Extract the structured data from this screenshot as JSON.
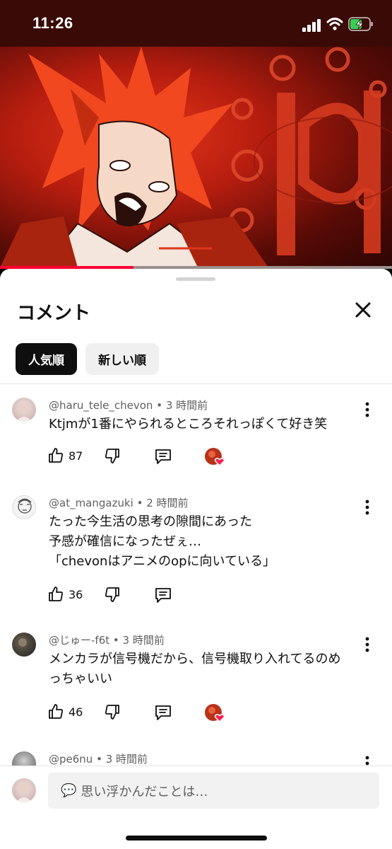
{
  "status_bar": {
    "time": "11:26",
    "icons": [
      "signal-icon",
      "wifi-icon",
      "battery-charging-icon"
    ]
  },
  "video": {
    "progress_fraction": 0.34,
    "accent_color": "#ff0033"
  },
  "sheet": {
    "title": "コメント",
    "close_icon": "close-icon",
    "chips": [
      {
        "label": "人気順",
        "active": true
      },
      {
        "label": "新しい順",
        "active": false
      }
    ]
  },
  "comments": [
    {
      "author": "@haru_tele_chevon",
      "time": "3 時間前",
      "lines": [
        "Ktjmが1番にやられるところそれっぽくて好き笑"
      ],
      "likes": "87",
      "creator_heart": true
    },
    {
      "author": "@at_mangazuki",
      "time": "2 時間前",
      "lines": [
        "たった今生活の思考の隙間にあった",
        "予感が確信になったぜぇ…",
        "「chevonはアニメのopに向いている」"
      ],
      "likes": "36",
      "creator_heart": false
    },
    {
      "author": "@じゅー-f6t",
      "time": "3 時間前",
      "lines": [
        "メンカラが信号機だから、信号機取り入れてるのめ",
        "っちゃいい"
      ],
      "likes": "46",
      "creator_heart": true
    },
    {
      "author": "@pe6nu",
      "time": "3 時間前",
      "lines": [],
      "likes": "",
      "creator_heart": false
    }
  ],
  "input": {
    "placeholder": "思い浮かんだことは…",
    "emoji": "💬"
  }
}
